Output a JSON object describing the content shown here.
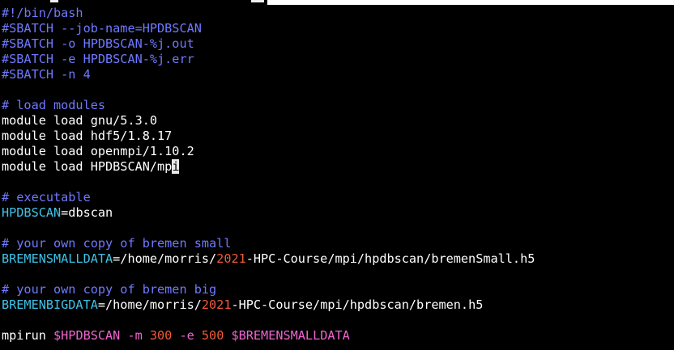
{
  "terminal": {
    "lines": {
      "shebang": "#!/bin/bash",
      "sbatch_job": "#SBATCH --job-name=HPDBSCAN",
      "sbatch_out": "#SBATCH -o HPDBSCAN-%j.out",
      "sbatch_err": "#SBATCH -e HPDBSCAN-%j.err",
      "sbatch_n": "#SBATCH -n 4",
      "comment_modules": "# load modules",
      "module_gnu": "module load gnu/5.3.0",
      "module_hdf5": "module load hdf5/1.8.17",
      "module_openmpi": "module load openmpi/1.10.2",
      "module_hpdbscan_prefix": "module load HPDBSCAN/mp",
      "module_hpdbscan_cursor_char": "i",
      "comment_executable": "# executable",
      "exec_var": "HPDBSCAN",
      "exec_value": "=dbscan",
      "comment_small": "# your own copy of bremen small",
      "small_var": "BREMENSMALLDATA",
      "small_path_a": "=/home/morris/",
      "small_year": "2021",
      "small_path_b": "-HPC-Course/mpi/hpdbscan/bremenSmall.h5",
      "comment_big": "# your own copy of bremen big",
      "big_var": "BREMENBIGDATA",
      "big_path_a": "=/home/morris/",
      "big_year": "2021",
      "big_path_b": "-HPC-Course/mpi/hpdbscan/bremen.h5",
      "run_cmd": "mpirun ",
      "run_var1": "$HPDBSCAN",
      "run_flag_m": " -m ",
      "run_m_val": "300",
      "run_flag_e": " -e ",
      "run_e_val": "500",
      "run_var2": " $BREMENSMALLDATA"
    }
  },
  "colors": {
    "background": "#000000",
    "comment": "#6f79ff",
    "variable": "#3ec3e8",
    "number": "#f05a3a",
    "flag": "#f065d0",
    "text": "#ffffff"
  }
}
